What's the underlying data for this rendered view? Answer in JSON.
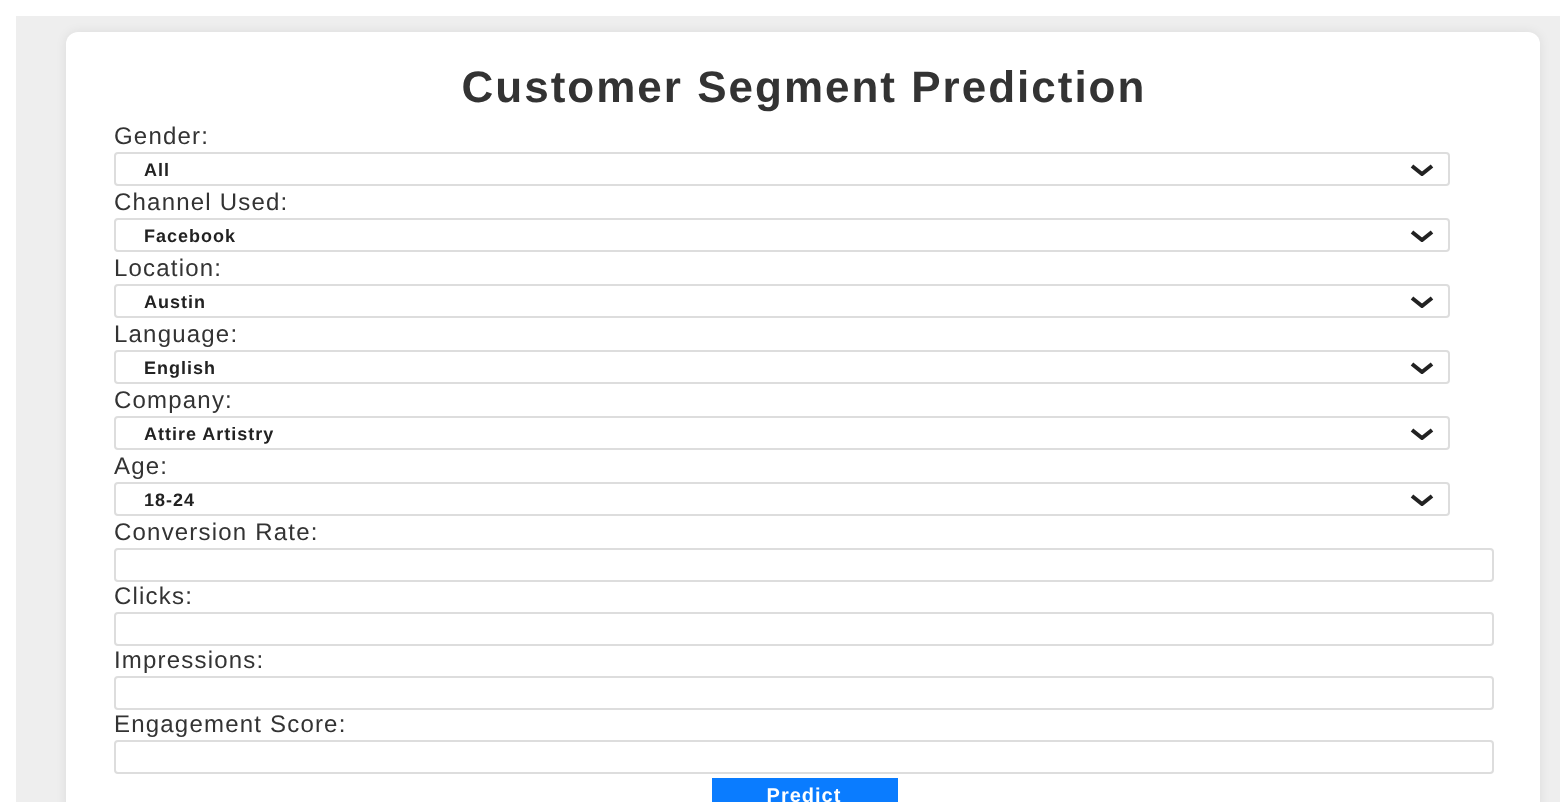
{
  "title": "Customer Segment Prediction",
  "fields": [
    {
      "kind": "select",
      "label": "Gender:",
      "value": "All"
    },
    {
      "kind": "select",
      "label": "Channel Used:",
      "value": "Facebook"
    },
    {
      "kind": "select",
      "label": "Location:",
      "value": "Austin"
    },
    {
      "kind": "select",
      "label": "Language:",
      "value": "English"
    },
    {
      "kind": "select",
      "label": "Company:",
      "value": "Attire Artistry"
    },
    {
      "kind": "select",
      "label": "Age:",
      "value": "18-24"
    },
    {
      "kind": "text",
      "label": "Conversion Rate:"
    },
    {
      "kind": "text",
      "label": "Clicks:"
    },
    {
      "kind": "text",
      "label": "Impressions:"
    },
    {
      "kind": "text",
      "label": "Engagement Score:"
    }
  ],
  "button": "Predict"
}
